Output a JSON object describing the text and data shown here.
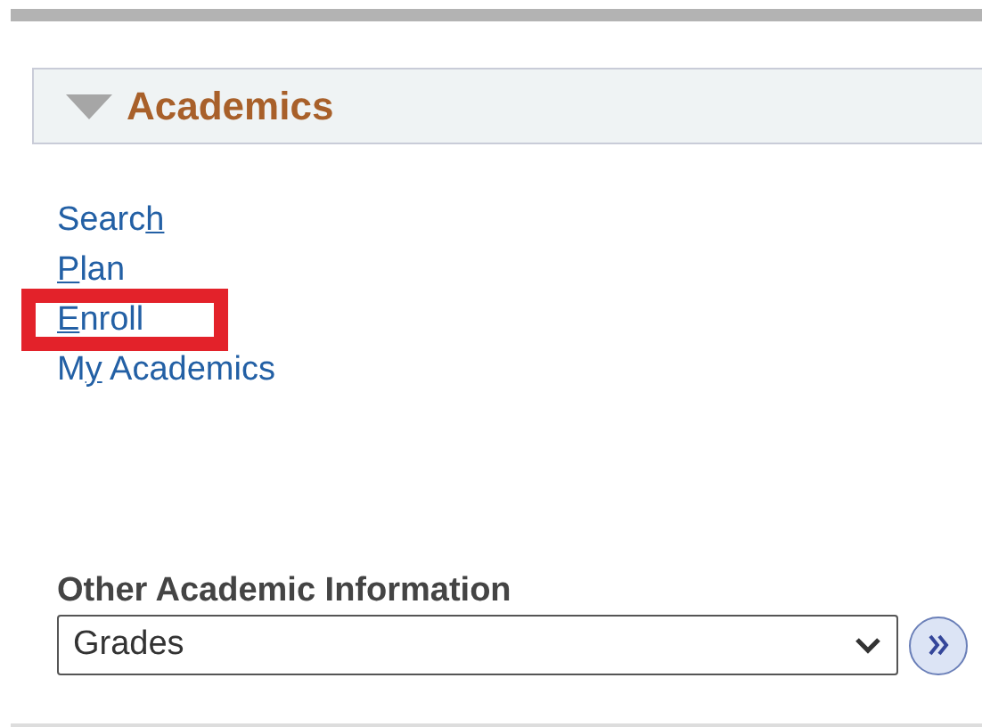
{
  "section": {
    "title": "Academics",
    "expanded": true
  },
  "links": [
    {
      "before": "Searc",
      "access_key": "h",
      "highlighted": false
    },
    {
      "access_key": "P",
      "after": "lan",
      "highlighted": false
    },
    {
      "access_key": "E",
      "after": "nroll",
      "highlighted": true
    },
    {
      "before": "M",
      "access_key": "y",
      "after": " Academics",
      "highlighted": false
    }
  ],
  "other_info": {
    "label": "Other Academic Information",
    "value": "Grades"
  }
}
